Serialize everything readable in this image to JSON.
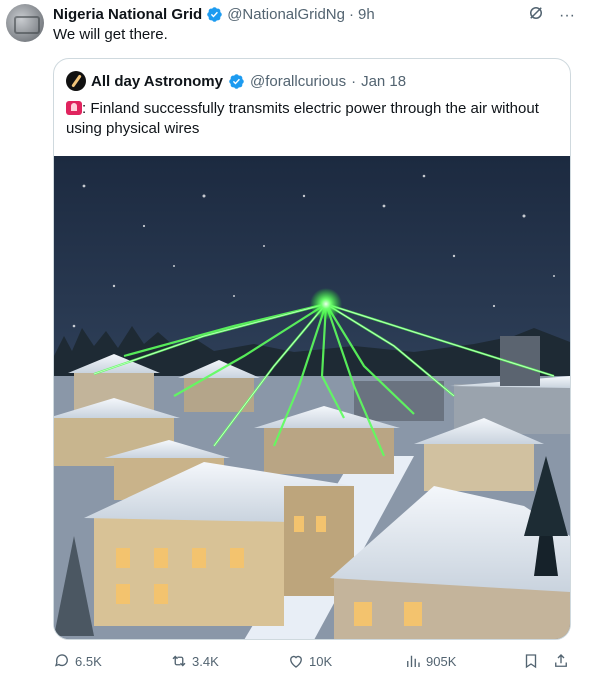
{
  "author": {
    "name": "Nigeria National Grid",
    "handle": "@NationalGridNg",
    "separator": "·",
    "time": "9h"
  },
  "tweet_text": "We will get there.",
  "top_icons": {
    "more": "···",
    "grok_icon": "slash-circle-icon"
  },
  "quoted": {
    "name": "All day Astronomy",
    "handle": "@forallcurious",
    "separator": "·",
    "time": "Jan 18",
    "text": ": Finland successfully transmits electric power through the air without using physical wires",
    "emoji_icon": "siren-icon"
  },
  "actions": {
    "replies": "6.5K",
    "reposts": "3.4K",
    "likes": "10K",
    "views": "905K"
  },
  "colors": {
    "accent": "#1d9bf0",
    "muted": "#536471",
    "border": "#cfd9de"
  }
}
